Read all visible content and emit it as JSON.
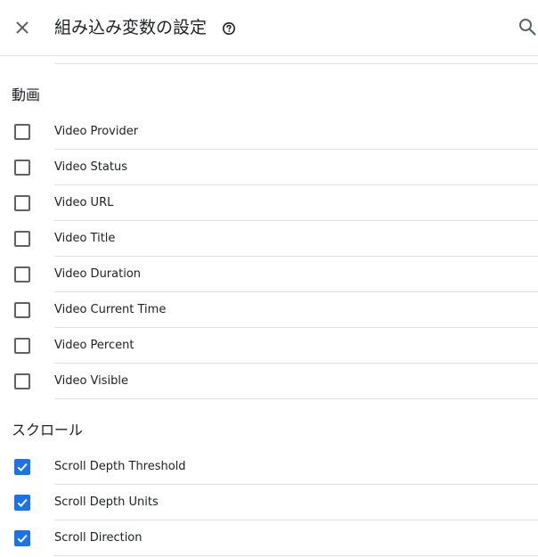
{
  "header": {
    "title": "組み込み変数の設定",
    "close_icon": "close-icon",
    "help_icon": "help-circle-icon",
    "search_icon": "search-icon"
  },
  "colors": {
    "accent": "#1a73e8",
    "divider": "#e0e0e0",
    "checkbox_border": "#5f6368",
    "text": "#202124"
  },
  "sections": [
    {
      "title": "動画",
      "items": [
        {
          "label": "Video Provider",
          "checked": false
        },
        {
          "label": "Video Status",
          "checked": false
        },
        {
          "label": "Video URL",
          "checked": false
        },
        {
          "label": "Video Title",
          "checked": false
        },
        {
          "label": "Video Duration",
          "checked": false
        },
        {
          "label": "Video Current Time",
          "checked": false
        },
        {
          "label": "Video Percent",
          "checked": false
        },
        {
          "label": "Video Visible",
          "checked": false
        }
      ]
    },
    {
      "title": "スクロール",
      "items": [
        {
          "label": "Scroll Depth Threshold",
          "checked": true
        },
        {
          "label": "Scroll Depth Units",
          "checked": true
        },
        {
          "label": "Scroll Direction",
          "checked": true
        }
      ]
    }
  ]
}
